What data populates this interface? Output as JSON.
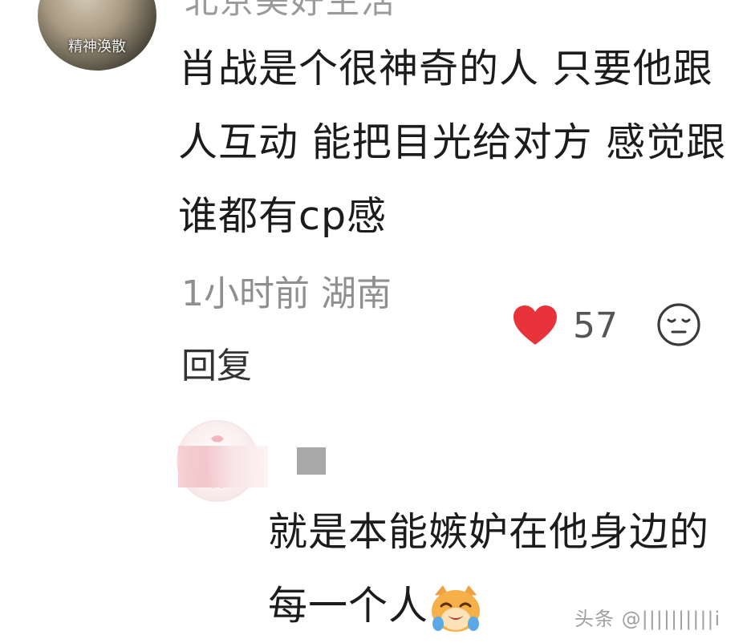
{
  "top_comment": {
    "username": "北京美好生活",
    "avatar_caption": "精神涣散",
    "text": "肖战是个很神奇的人 只要他跟人互动 能把目光给对方 感觉跟谁都有cp感",
    "time_location": "1小时前 湖南",
    "reply_label": "回复",
    "like_count": "57",
    "like_color": "#e8333b",
    "icons": [
      "heart-icon",
      "dislike-face-icon"
    ]
  },
  "reply_comment": {
    "text": "就是本能嫉妒在他身边的每一个人",
    "emoji": "crying-cat-emoji"
  },
  "watermark": {
    "text": "头条 @||||||||||i"
  }
}
